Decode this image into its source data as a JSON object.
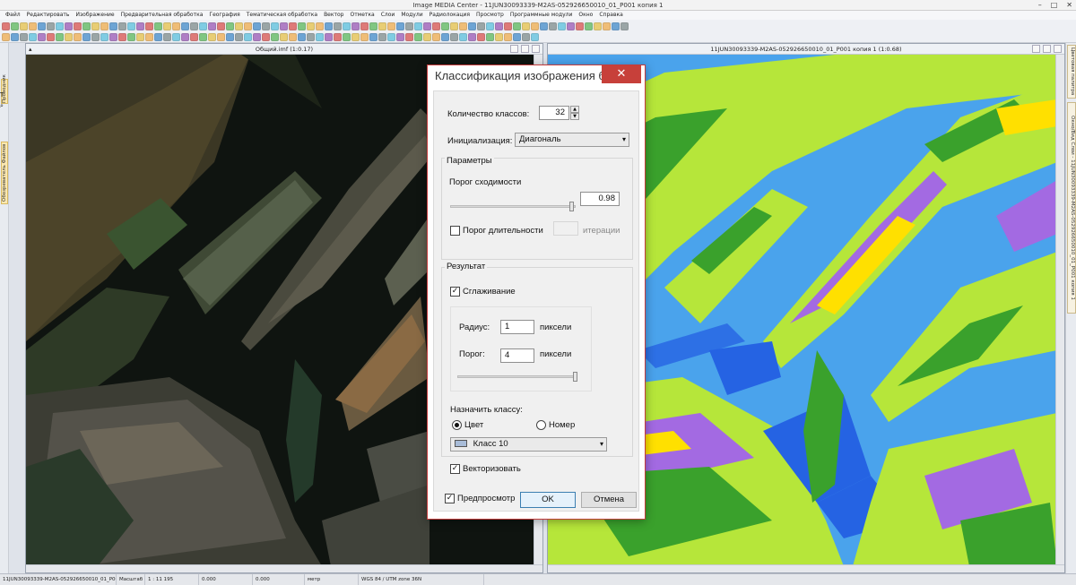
{
  "app": {
    "title": "Image MEDIA Center - 11JUN30093339-M2AS-052926650010_01_P001 копия 1",
    "window_controls": [
      "–",
      "□",
      "✕"
    ]
  },
  "menu": [
    "Файл",
    "Редактировать",
    "Изображение",
    "Предварительная обработка",
    "География",
    "Тематическая обработка",
    "Вектор",
    "Отметка",
    "Слои",
    "Модули",
    "Радиолокация",
    "Просмотр",
    "Программные модули",
    "Окно",
    "Справка"
  ],
  "left_tabs": {
    "tab1": "Проводник",
    "tab2": "Обозреватель Файлов"
  },
  "right_tabs": {
    "tab1": "Цветовая палитра",
    "tab2": "Окно/Вид Слои - 11JUN30093339-M2AS-052926650010_01_P001 копия 1"
  },
  "left_pane": {
    "title": "Общий.imf",
    "zoom": "(1:0.17)"
  },
  "right_pane": {
    "title": "11JUN30093339-M2AS-052926650010_01_P001 копия 1",
    "zoom": "(1:0.68)"
  },
  "dialog": {
    "title": "Классификация изображения без...",
    "close_icon": "close-icon",
    "classes_label": "Количество классов:",
    "classes_value": "32",
    "init_label": "Инициализация:",
    "init_value": "Диагональ",
    "params_group": "Параметры",
    "threshold_label": "Порог сходимости",
    "threshold_value": "0.98",
    "duration_label": "Порог длительности",
    "duration_checked": false,
    "iterations_label": "итерации",
    "result_group": "Результат",
    "smoothing_label": "Сглаживание",
    "smoothing_checked": true,
    "radius_label": "Радиус:",
    "radius_value": "1",
    "radius_unit": "пиксели",
    "threshold2_label": "Порог:",
    "threshold2_value": "4",
    "threshold2_unit": "пиксели",
    "assign_label": "Назначить классу:",
    "color_radio": "Цвет",
    "number_radio": "Номер",
    "selected_radio": "color",
    "class_value": "Класс 10",
    "class_swatch_color": "#a8bcd8",
    "vectorize_label": "Векторизовать",
    "vectorize_checked": true,
    "preview_label": "Предпросмотр",
    "preview_checked": true,
    "ok_label": "OK",
    "cancel_label": "Отмена"
  },
  "status": {
    "file": "11JUN30093339-M2AS-052926650010_01_P001...",
    "scale_label": "Масштаб",
    "scale_value": "1 : 11 195",
    "coord_x": "0.000",
    "coord_y": "0.000",
    "units": "метр",
    "projection": "WGS 84 / UTM zone 36N"
  },
  "colors": {
    "water": "#4aa3ec",
    "deep_water": "#2563e3",
    "land_yellowgreen": "#b6e63a",
    "land_green": "#3aa12c",
    "purple": "#a36ae2",
    "yellow": "#ffe000",
    "dialog_close": "#c7403a"
  }
}
